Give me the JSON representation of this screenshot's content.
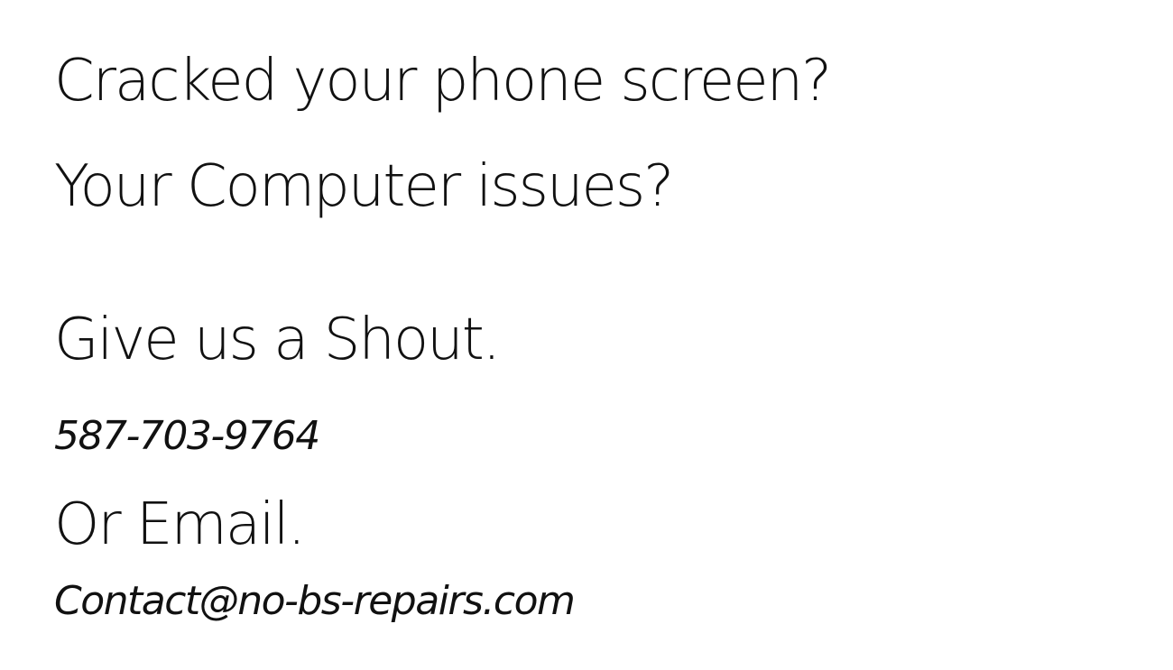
{
  "content": {
    "line1": "Cracked your phone screen?",
    "line2": "Your Computer issues?",
    "cta_shout": "Give us a Shout.",
    "phone": "587-703-9764",
    "cta_email": "Or Email.",
    "email": "Contact@no-bs-repairs.com"
  },
  "colors": {
    "text": "#111111",
    "background": "#ffffff"
  }
}
